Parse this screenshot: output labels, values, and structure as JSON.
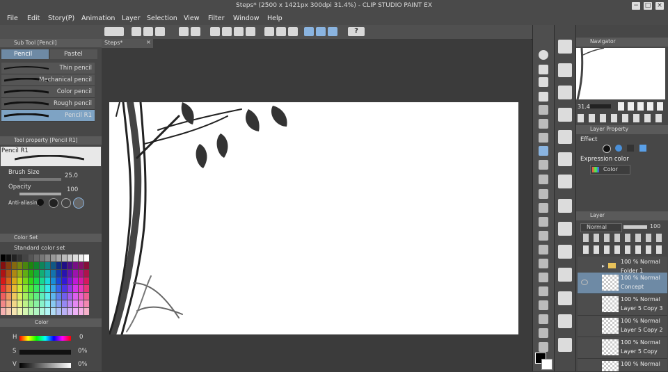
{
  "window": {
    "title": "Steps* (2500 x 1421px 300dpi 31.4%) - CLIP STUDIO PAINT EX",
    "min": "−",
    "max": "□",
    "close": "×"
  },
  "menu": [
    "File",
    "Edit",
    "Story(P)",
    "Animation",
    "Layer",
    "Selection",
    "View",
    "Filter",
    "Window",
    "Help"
  ],
  "toolbar": {
    "help_label": "?"
  },
  "subtool": {
    "header": "Sub Tool [Pencil]",
    "tabs": [
      "Pencil",
      "Pastel"
    ],
    "brushes": [
      "Thin pencil",
      "Mechanical pencil",
      "Color pencil",
      "Rough pencil",
      "Pencil R1"
    ],
    "selected_index": 4
  },
  "toolprop": {
    "header": "Tool property [Pencil R1]",
    "brush_name": "Pencil R1",
    "brush_size_label": "Brush Size",
    "brush_size_value": "25.0",
    "opacity_label": "Opacity",
    "opacity_value": "100",
    "antialias_label": "Anti-aliasing"
  },
  "colorset": {
    "header": "Color Set",
    "name": "Standard color set"
  },
  "color": {
    "header": "Color",
    "h_label": "H",
    "s_label": "S",
    "v_label": "V",
    "h_value": "0",
    "s_value": "0%",
    "v_value": "0%"
  },
  "canvas_tab": "Steps*",
  "navigator": {
    "header": "Navigator",
    "zoom": "31.4"
  },
  "layer_property": {
    "header": "Layer Property",
    "effect_label": "Effect",
    "expression_label": "Expression color",
    "expression_value": "Color"
  },
  "layer_panel": {
    "header": "Layer",
    "blend": "Normal",
    "opacity": "100",
    "layers": [
      {
        "line1": "100 % Normal",
        "line2": "Folder 1",
        "selected": false
      },
      {
        "line1": "100 % Normal",
        "line2": "Concept",
        "selected": true
      },
      {
        "line1": "100 % Normal",
        "line2": "Layer 5 Copy 3",
        "selected": false
      },
      {
        "line1": "100 % Normal",
        "line2": "Layer 5 Copy 2",
        "selected": false
      },
      {
        "line1": "100 % Normal",
        "line2": "Layer 5 Copy",
        "selected": false
      },
      {
        "line1": "100 % Normal",
        "line2": "",
        "selected": false
      }
    ]
  },
  "colors": {
    "accent": "#6e8aa5",
    "selected_brush": "#7ea3c4",
    "panel": "#474747"
  }
}
